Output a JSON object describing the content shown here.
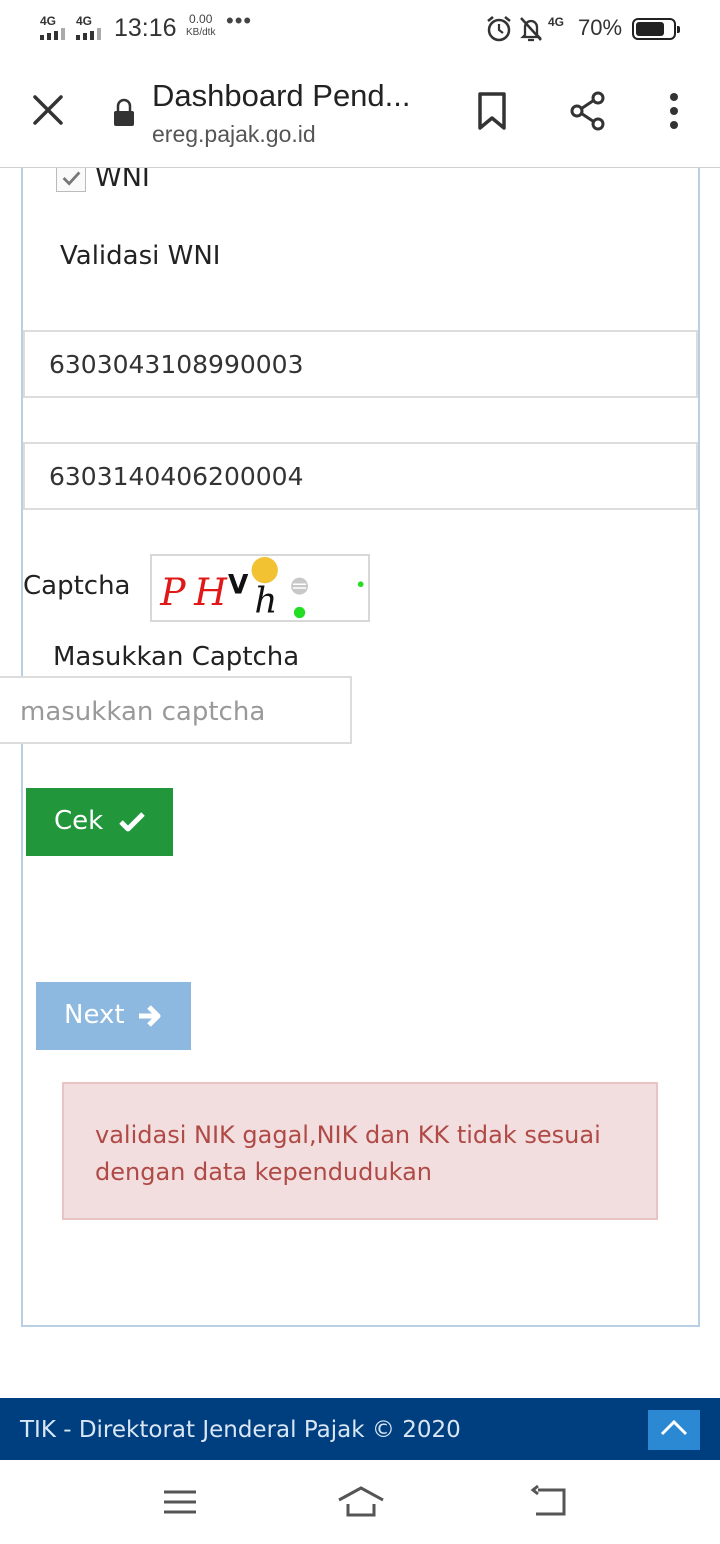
{
  "status_bar": {
    "network1": "4G",
    "network2": "4G",
    "time": "13:16",
    "speed_value": "0.00",
    "speed_unit": "KB/dtk",
    "more": "•••",
    "network3": "4G",
    "battery_percent": "70%",
    "battery_level": 0.7
  },
  "browser": {
    "title": "Dashboard Pend...",
    "url": "ereg.pajak.go.id"
  },
  "form": {
    "wni_label": "WNI",
    "validasi_label": "Validasi WNI",
    "nik_value": "6303043108990003",
    "kk_value": "6303140406200004",
    "captcha_label": "Captcha",
    "captcha_chars": [
      "P",
      "H",
      "V",
      "h"
    ],
    "masukkan_label": "Masukkan Captcha",
    "captcha_placeholder": "masukkan captcha",
    "cek_label": "Cek",
    "next_label": "Next",
    "alert_line1": "validasi NIK gagal,NIK dan KK tidak sesuai",
    "alert_line2": "dengan data kependudukan"
  },
  "footer": {
    "text": "TIK - Direktorat Jenderal Pajak © 2020"
  },
  "colors": {
    "cek_button": "#21963b",
    "next_button": "#8db8df",
    "footer_bg": "#003f7f",
    "alert_bg": "#f2dede",
    "alert_text": "#b04a47"
  }
}
